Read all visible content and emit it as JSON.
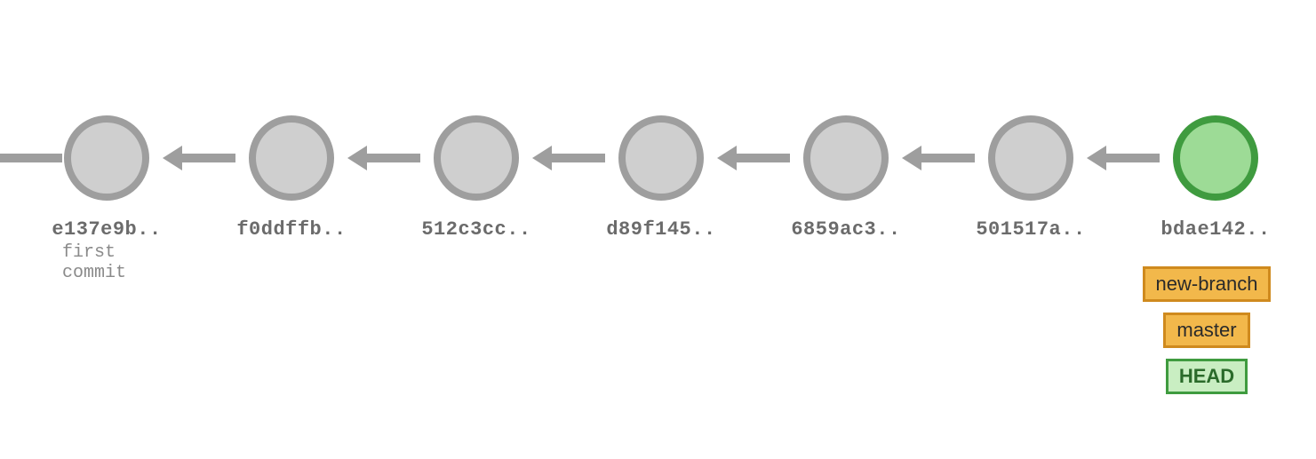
{
  "commits": [
    {
      "hash": "e137e9b..",
      "message": "first commit",
      "head": false
    },
    {
      "hash": "f0ddffb..",
      "message": "",
      "head": false
    },
    {
      "hash": "512c3cc..",
      "message": "",
      "head": false
    },
    {
      "hash": "d89f145..",
      "message": "",
      "head": false
    },
    {
      "hash": "6859ac3..",
      "message": "",
      "head": false
    },
    {
      "hash": "501517a..",
      "message": "",
      "head": false
    },
    {
      "hash": "bdae142..",
      "message": "",
      "head": true
    }
  ],
  "refs": [
    {
      "name": "new-branch",
      "type": "branch"
    },
    {
      "name": "master",
      "type": "branch"
    },
    {
      "name": "HEAD",
      "type": "head"
    }
  ],
  "colors": {
    "node_fill": "#cfcfcf",
    "node_stroke": "#9e9e9e",
    "head_fill": "#9ddb96",
    "head_stroke": "#3f9b3f",
    "branch_fill": "#f2b84b",
    "branch_stroke": "#cf8a1e"
  }
}
